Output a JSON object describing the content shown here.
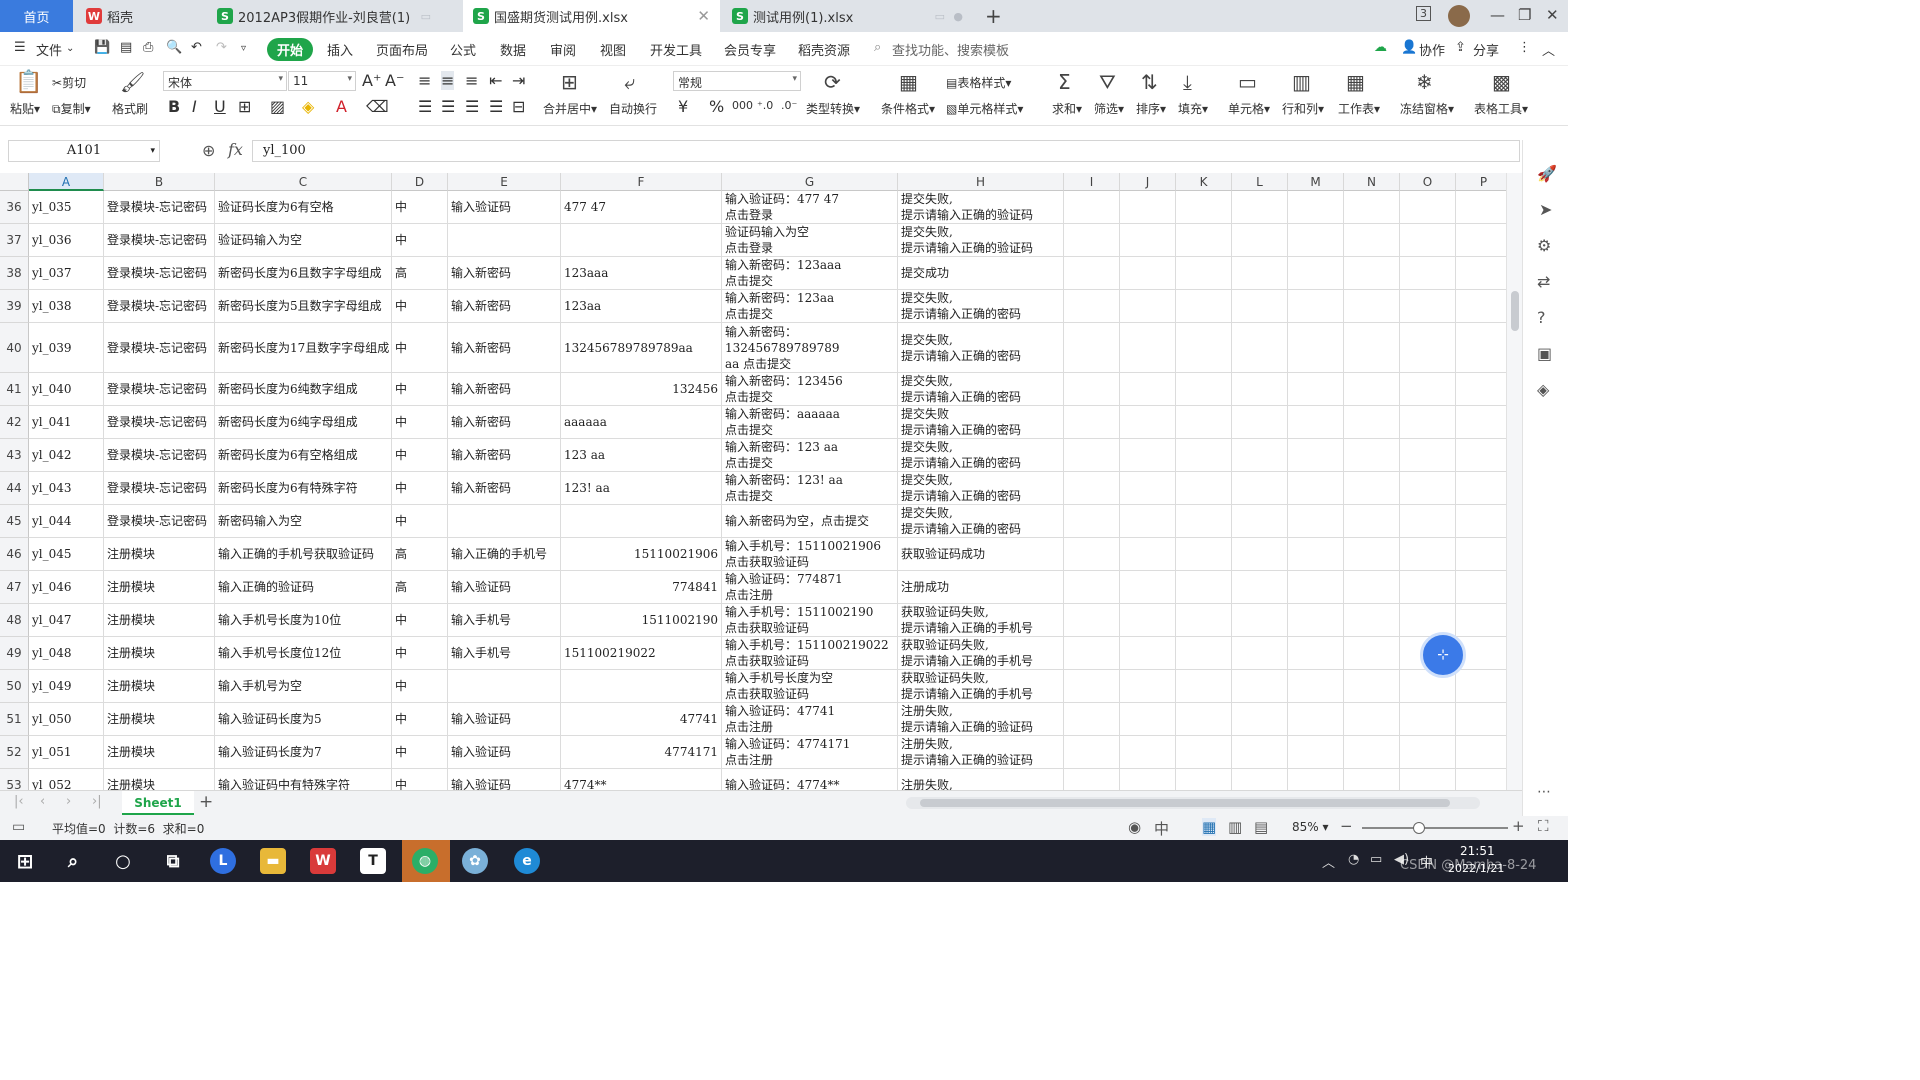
{
  "tabs": [
    {
      "label": "首页",
      "kind": "home"
    },
    {
      "label": "稻壳",
      "kind": "doc",
      "color": "#e03b3b",
      "glyph": "W"
    },
    {
      "label": "2012AP3假期作业-刘良营(1)",
      "kind": "xls",
      "color": "#1fa54a",
      "glyph": "S"
    },
    {
      "label": "国盛期货测试用例.xlsx",
      "kind": "xls",
      "color": "#1fa54a",
      "glyph": "S",
      "active": true
    },
    {
      "label": "测试用例(1).xlsx",
      "kind": "xls",
      "color": "#1fa54a",
      "glyph": "S"
    }
  ],
  "tab_add": "+",
  "window_badge": "3",
  "menu": {
    "file": "文件",
    "items": [
      "开始",
      "插入",
      "页面布局",
      "公式",
      "数据",
      "审阅",
      "视图",
      "开发工具",
      "会员专享",
      "稻壳资源"
    ],
    "search": "查找功能、搜索模板",
    "collab": "协作",
    "share": "分享"
  },
  "ribbon": {
    "paste": "粘贴",
    "cut": "剪切",
    "copy": "复制",
    "format_painter": "格式刷",
    "font": "宋体",
    "size": "11",
    "number_format": "常规",
    "merge": "合并居中",
    "wrap": "自动换行",
    "type_convert": "类型转换",
    "cond_format": "条件格式",
    "table_style": "表格样式",
    "cell_style": "单元格样式",
    "sum": "求和",
    "filter": "筛选",
    "sort": "排序",
    "fill": "填充",
    "cell": "单元格",
    "rowcol": "行和列",
    "sheet": "工作表",
    "freeze": "冻结窗格",
    "tools": "表格工具"
  },
  "formula_bar": {
    "name_box": "A101",
    "fx": "fx",
    "content": "yl_100"
  },
  "columns": [
    "A",
    "B",
    "C",
    "D",
    "E",
    "F",
    "G",
    "H",
    "I",
    "J",
    "K",
    "L",
    "M",
    "N",
    "O",
    "P"
  ],
  "rows": [
    {
      "n": "36",
      "a": "yl_035",
      "b": "登录模块-忘记密码",
      "c": "验证码长度为6有空格",
      "d": "中",
      "e": "输入验证码",
      "f": "477 47",
      "g": "输入验证码：477 47\n点击登录",
      "h": "提交失败,\n提示请输入正确的验证码"
    },
    {
      "n": "37",
      "a": "yl_036",
      "b": "登录模块-忘记密码",
      "c": "验证码输入为空",
      "d": "中",
      "e": "",
      "f": "",
      "g": "验证码输入为空\n点击登录",
      "h": "提交失败,\n提示请输入正确的验证码"
    },
    {
      "n": "38",
      "a": "yl_037",
      "b": "登录模块-忘记密码",
      "c": "新密码长度为6且数字字母组成",
      "d": "高",
      "e": "输入新密码",
      "f": "123aaa",
      "g": "输入新密码：123aaa\n点击提交",
      "h": "提交成功"
    },
    {
      "n": "39",
      "a": "yl_038",
      "b": "登录模块-忘记密码",
      "c": "新密码长度为5且数字字母组成",
      "d": "中",
      "e": "输入新密码",
      "f": "123aa",
      "g": "输入新密码：123aa\n点击提交",
      "h": "提交失败,\n提示请输入正确的密码"
    },
    {
      "n": "40",
      "a": "yl_039",
      "b": "登录模块-忘记密码",
      "c": "新密码长度为17且数字字母组成",
      "d": "中",
      "e": "输入新密码",
      "f": "132456789789789aa",
      "g": "输入新密码：\n132456789789789\naa 点击提交",
      "h": "提交失败,\n提示请输入正确的密码"
    },
    {
      "n": "41",
      "a": "yl_040",
      "b": "登录模块-忘记密码",
      "c": "新密码长度为6纯数字组成",
      "d": "中",
      "e": "输入新密码",
      "f": "132456",
      "f_right": true,
      "g": "输入新密码：123456\n点击提交",
      "h": "提交失败,\n提示请输入正确的密码"
    },
    {
      "n": "42",
      "a": "yl_041",
      "b": "登录模块-忘记密码",
      "c": "新密码长度为6纯字母组成",
      "d": "中",
      "e": "输入新密码",
      "f": "aaaaaa",
      "g": "输入新密码：aaaaaa\n点击提交",
      "h": "提交失败\n提示请输入正确的密码"
    },
    {
      "n": "43",
      "a": "yl_042",
      "b": "登录模块-忘记密码",
      "c": "新密码长度为6有空格组成",
      "d": "中",
      "e": "输入新密码",
      "f": "123 aa",
      "g": "输入新密码：123 aa\n点击提交",
      "h": "提交失败,\n提示请输入正确的密码"
    },
    {
      "n": "44",
      "a": "yl_043",
      "b": "登录模块-忘记密码",
      "c": "新密码长度为6有特殊字符",
      "d": "中",
      "e": "输入新密码",
      "f": "123! aa",
      "g": "输入新密码：123! aa\n点击提交",
      "h": "提交失败,\n提示请输入正确的密码"
    },
    {
      "n": "45",
      "a": "yl_044",
      "b": "登录模块-忘记密码",
      "c": "新密码输入为空",
      "d": "中",
      "e": "",
      "f": "",
      "g": "输入新密码为空，点击提交",
      "h": "提交失败,\n提示请输入正确的密码"
    },
    {
      "n": "46",
      "a": "yl_045",
      "b": "注册模块",
      "c": "输入正确的手机号获取验证码",
      "d": "高",
      "e": "输入正确的手机号",
      "f": "15110021906",
      "f_right": true,
      "g": "输入手机号：15110021906\n点击获取验证码",
      "h": "获取验证码成功"
    },
    {
      "n": "47",
      "a": "yl_046",
      "b": "注册模块",
      "c": "输入正确的验证码",
      "d": "高",
      "e": "输入验证码",
      "f": "774841",
      "f_right": true,
      "g": "输入验证码：774871\n点击注册",
      "h": "注册成功"
    },
    {
      "n": "48",
      "a": "yl_047",
      "b": "注册模块",
      "c": "输入手机号长度为10位",
      "d": "中",
      "e": "输入手机号",
      "f": "1511002190",
      "f_right": true,
      "g": "输入手机号：1511002190\n点击获取验证码",
      "h": "获取验证码失败,\n提示请输入正确的手机号"
    },
    {
      "n": "49",
      "a": "yl_048",
      "b": "注册模块",
      "c": "输入手机号长度位12位",
      "d": "中",
      "e": "输入手机号",
      "f": "151100219022",
      "g": "输入手机号：151100219022\n点击获取验证码",
      "h": "获取验证码失败,\n提示请输入正确的手机号"
    },
    {
      "n": "50",
      "a": "yl_049",
      "b": "注册模块",
      "c": "输入手机号为空",
      "d": "中",
      "e": "",
      "f": "",
      "g": "输入手机号长度为空\n点击获取验证码",
      "h": "获取验证码失败,\n提示请输入正确的手机号"
    },
    {
      "n": "51",
      "a": "yl_050",
      "b": "注册模块",
      "c": "输入验证码长度为5",
      "d": "中",
      "e": "输入验证码",
      "f": "47741",
      "f_right": true,
      "g": "输入验证码：47741\n点击注册",
      "h": "注册失败,\n提示请输入正确的验证码"
    },
    {
      "n": "52",
      "a": "yl_051",
      "b": "注册模块",
      "c": "输入验证码长度为7",
      "d": "中",
      "e": "输入验证码",
      "f": "4774171",
      "f_right": true,
      "g": "输入验证码：4774171\n点击注册",
      "h": "注册失败,\n提示请输入正确的验证码"
    },
    {
      "n": "53",
      "a": "yl_052",
      "b": "注册模块",
      "c": "输入验证码中有特殊字符",
      "d": "中",
      "e": "输入验证码",
      "f": "4774**",
      "g": "输入验证码：4774**",
      "h": "注册失败,"
    }
  ],
  "sheet": {
    "name": "Sheet1",
    "add": "+"
  },
  "status": {
    "stats": "平均值=0  计数=6  求和=0",
    "zoom": "85%"
  },
  "taskbar": {
    "time": "21:51",
    "date": "2022/1/21",
    "watermark": "CSDN @Mamba-8-24"
  },
  "colors": {
    "accent_green": "#1fa54a",
    "home_tab": "#3a7bde",
    "taskbar": "#1d1f2b"
  }
}
